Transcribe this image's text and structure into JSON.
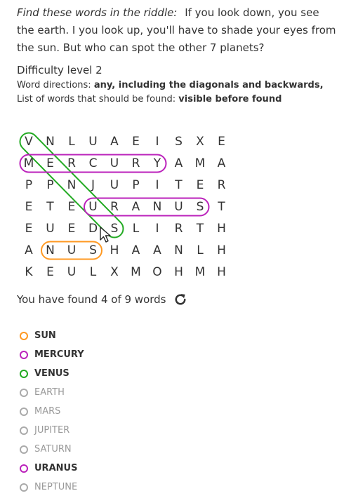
{
  "intro": {
    "lead": "Find these words in the riddle:",
    "text": "If you look down, you see the earth. I you look up, you'll have to shade your eyes from the sun. But who can spot the other 7 planets?"
  },
  "difficulty": "Difficulty level 2",
  "directions": {
    "label": "Word directions:",
    "value": "any, including the diagonals and backwards,"
  },
  "list_line": {
    "label": "List of words that should be found:",
    "value": "visible before found"
  },
  "grid": [
    [
      "V",
      "N",
      "L",
      "U",
      "A",
      "E",
      "I",
      "S",
      "X",
      "E"
    ],
    [
      "M",
      "E",
      "R",
      "C",
      "U",
      "R",
      "Y",
      "A",
      "M",
      "A"
    ],
    [
      "P",
      "P",
      "N",
      "J",
      "U",
      "P",
      "I",
      "T",
      "E",
      "R"
    ],
    [
      "E",
      "T",
      "E",
      "U",
      "R",
      "A",
      "N",
      "U",
      "S",
      "T"
    ],
    [
      "E",
      "U",
      "E",
      "D",
      "S",
      "L",
      "I",
      "R",
      "T",
      "H"
    ],
    [
      "A",
      "N",
      "U",
      "S",
      "H",
      "A",
      "A",
      "N",
      "L",
      "H"
    ],
    [
      "K",
      "E",
      "U",
      "L",
      "X",
      "M",
      "O",
      "H",
      "M",
      "H"
    ]
  ],
  "highlights": [
    {
      "word": "VENUS",
      "color": "#22aa22",
      "from": [
        0,
        0
      ],
      "to": [
        4,
        4
      ]
    },
    {
      "word": "MERCURY",
      "color": "#bb22bb",
      "from": [
        1,
        0
      ],
      "to": [
        1,
        6
      ]
    },
    {
      "word": "URANUS",
      "color": "#bb22bb",
      "from": [
        3,
        3
      ],
      "to": [
        3,
        8
      ]
    },
    {
      "word": "SUN",
      "color": "#ff9922",
      "from": [
        5,
        1
      ],
      "to": [
        5,
        3
      ]
    }
  ],
  "status": {
    "text": "You have found 4 of 9 words",
    "refresh_icon": "refresh-icon"
  },
  "words": [
    {
      "label": "SUN",
      "found": true,
      "color": "#ff9922"
    },
    {
      "label": "MERCURY",
      "found": true,
      "color": "#bb22bb"
    },
    {
      "label": "VENUS",
      "found": true,
      "color": "#22aa22"
    },
    {
      "label": "EARTH",
      "found": false,
      "color": "#aaaaaa"
    },
    {
      "label": "MARS",
      "found": false,
      "color": "#aaaaaa"
    },
    {
      "label": "JUPITER",
      "found": false,
      "color": "#aaaaaa"
    },
    {
      "label": "SATURN",
      "found": false,
      "color": "#aaaaaa"
    },
    {
      "label": "URANUS",
      "found": true,
      "color": "#bb22bb"
    },
    {
      "label": "NEPTUNE",
      "found": false,
      "color": "#aaaaaa"
    }
  ]
}
